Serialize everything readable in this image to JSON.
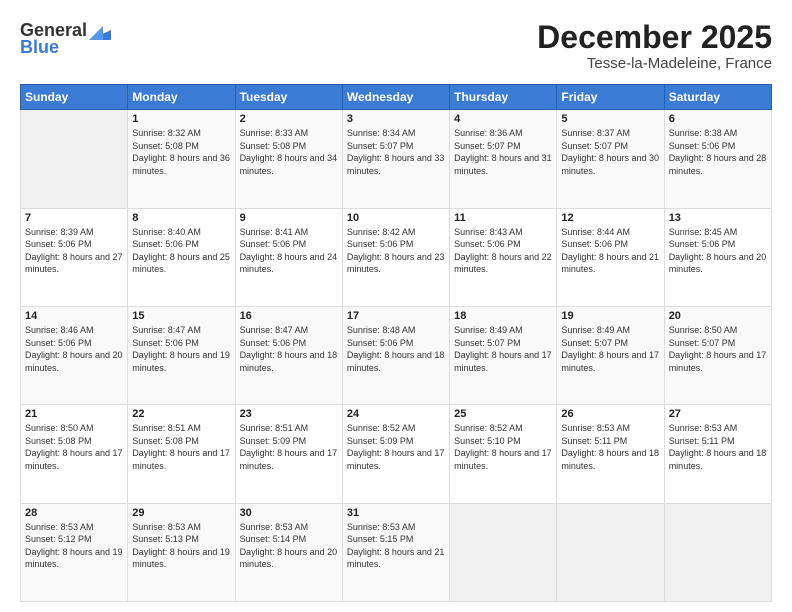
{
  "logo": {
    "general": "General",
    "blue": "Blue"
  },
  "header": {
    "month": "December 2025",
    "location": "Tesse-la-Madeleine, France"
  },
  "weekdays": [
    "Sunday",
    "Monday",
    "Tuesday",
    "Wednesday",
    "Thursday",
    "Friday",
    "Saturday"
  ],
  "weeks": [
    [
      {
        "day": "",
        "sunrise": "",
        "sunset": "",
        "daylight": ""
      },
      {
        "day": "1",
        "sunrise": "8:32 AM",
        "sunset": "5:08 PM",
        "daylight": "8 hours and 36 minutes."
      },
      {
        "day": "2",
        "sunrise": "8:33 AM",
        "sunset": "5:08 PM",
        "daylight": "8 hours and 34 minutes."
      },
      {
        "day": "3",
        "sunrise": "8:34 AM",
        "sunset": "5:07 PM",
        "daylight": "8 hours and 33 minutes."
      },
      {
        "day": "4",
        "sunrise": "8:36 AM",
        "sunset": "5:07 PM",
        "daylight": "8 hours and 31 minutes."
      },
      {
        "day": "5",
        "sunrise": "8:37 AM",
        "sunset": "5:07 PM",
        "daylight": "8 hours and 30 minutes."
      },
      {
        "day": "6",
        "sunrise": "8:38 AM",
        "sunset": "5:06 PM",
        "daylight": "8 hours and 28 minutes."
      }
    ],
    [
      {
        "day": "7",
        "sunrise": "8:39 AM",
        "sunset": "5:06 PM",
        "daylight": "8 hours and 27 minutes."
      },
      {
        "day": "8",
        "sunrise": "8:40 AM",
        "sunset": "5:06 PM",
        "daylight": "8 hours and 25 minutes."
      },
      {
        "day": "9",
        "sunrise": "8:41 AM",
        "sunset": "5:06 PM",
        "daylight": "8 hours and 24 minutes."
      },
      {
        "day": "10",
        "sunrise": "8:42 AM",
        "sunset": "5:06 PM",
        "daylight": "8 hours and 23 minutes."
      },
      {
        "day": "11",
        "sunrise": "8:43 AM",
        "sunset": "5:06 PM",
        "daylight": "8 hours and 22 minutes."
      },
      {
        "day": "12",
        "sunrise": "8:44 AM",
        "sunset": "5:06 PM",
        "daylight": "8 hours and 21 minutes."
      },
      {
        "day": "13",
        "sunrise": "8:45 AM",
        "sunset": "5:06 PM",
        "daylight": "8 hours and 20 minutes."
      }
    ],
    [
      {
        "day": "14",
        "sunrise": "8:46 AM",
        "sunset": "5:06 PM",
        "daylight": "8 hours and 20 minutes."
      },
      {
        "day": "15",
        "sunrise": "8:47 AM",
        "sunset": "5:06 PM",
        "daylight": "8 hours and 19 minutes."
      },
      {
        "day": "16",
        "sunrise": "8:47 AM",
        "sunset": "5:06 PM",
        "daylight": "8 hours and 18 minutes."
      },
      {
        "day": "17",
        "sunrise": "8:48 AM",
        "sunset": "5:06 PM",
        "daylight": "8 hours and 18 minutes."
      },
      {
        "day": "18",
        "sunrise": "8:49 AM",
        "sunset": "5:07 PM",
        "daylight": "8 hours and 17 minutes."
      },
      {
        "day": "19",
        "sunrise": "8:49 AM",
        "sunset": "5:07 PM",
        "daylight": "8 hours and 17 minutes."
      },
      {
        "day": "20",
        "sunrise": "8:50 AM",
        "sunset": "5:07 PM",
        "daylight": "8 hours and 17 minutes."
      }
    ],
    [
      {
        "day": "21",
        "sunrise": "8:50 AM",
        "sunset": "5:08 PM",
        "daylight": "8 hours and 17 minutes."
      },
      {
        "day": "22",
        "sunrise": "8:51 AM",
        "sunset": "5:08 PM",
        "daylight": "8 hours and 17 minutes."
      },
      {
        "day": "23",
        "sunrise": "8:51 AM",
        "sunset": "5:09 PM",
        "daylight": "8 hours and 17 minutes."
      },
      {
        "day": "24",
        "sunrise": "8:52 AM",
        "sunset": "5:09 PM",
        "daylight": "8 hours and 17 minutes."
      },
      {
        "day": "25",
        "sunrise": "8:52 AM",
        "sunset": "5:10 PM",
        "daylight": "8 hours and 17 minutes."
      },
      {
        "day": "26",
        "sunrise": "8:53 AM",
        "sunset": "5:11 PM",
        "daylight": "8 hours and 18 minutes."
      },
      {
        "day": "27",
        "sunrise": "8:53 AM",
        "sunset": "5:11 PM",
        "daylight": "8 hours and 18 minutes."
      }
    ],
    [
      {
        "day": "28",
        "sunrise": "8:53 AM",
        "sunset": "5:12 PM",
        "daylight": "8 hours and 19 minutes."
      },
      {
        "day": "29",
        "sunrise": "8:53 AM",
        "sunset": "5:13 PM",
        "daylight": "8 hours and 19 minutes."
      },
      {
        "day": "30",
        "sunrise": "8:53 AM",
        "sunset": "5:14 PM",
        "daylight": "8 hours and 20 minutes."
      },
      {
        "day": "31",
        "sunrise": "8:53 AM",
        "sunset": "5:15 PM",
        "daylight": "8 hours and 21 minutes."
      },
      {
        "day": "",
        "sunrise": "",
        "sunset": "",
        "daylight": ""
      },
      {
        "day": "",
        "sunrise": "",
        "sunset": "",
        "daylight": ""
      },
      {
        "day": "",
        "sunrise": "",
        "sunset": "",
        "daylight": ""
      }
    ]
  ]
}
